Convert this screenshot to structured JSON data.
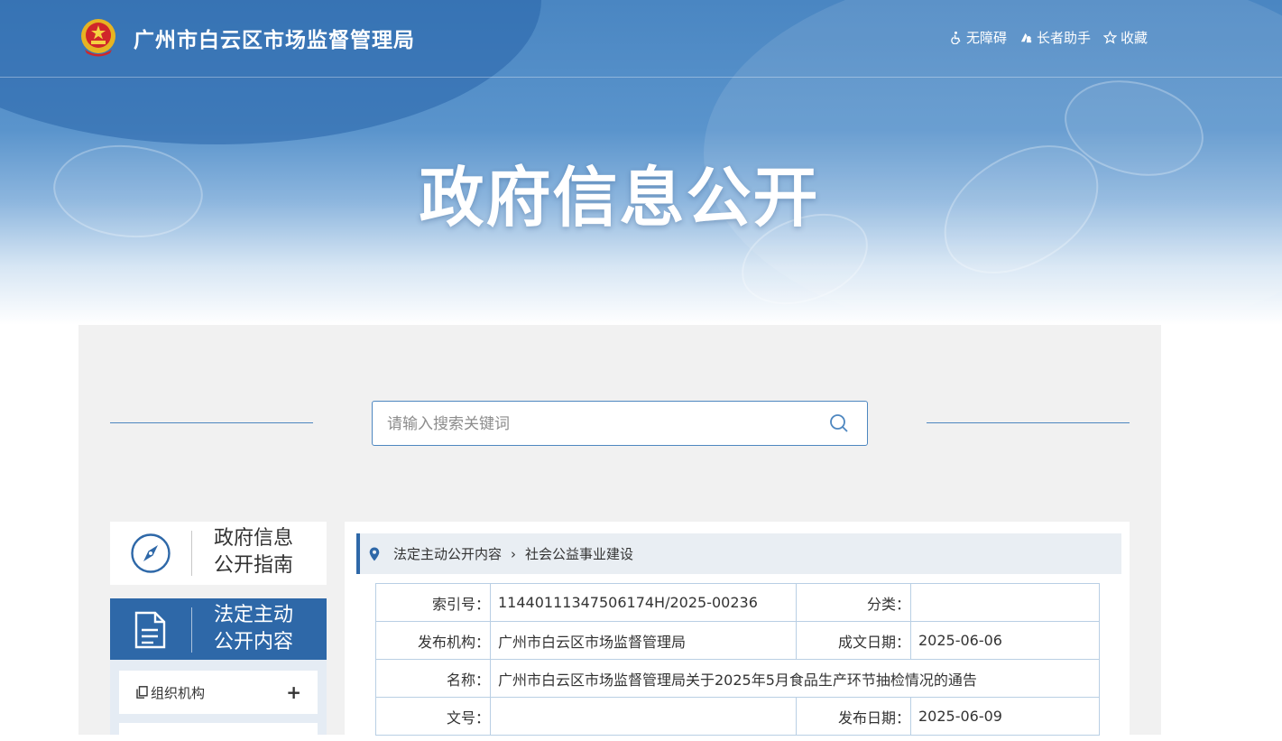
{
  "header": {
    "site_title": "广州市白云区市场监督管理局",
    "tools": [
      {
        "label": "无障碍",
        "icon": "accessibility-icon"
      },
      {
        "label": "长者助手",
        "icon": "elder-assist-icon"
      },
      {
        "label": "收藏",
        "icon": "star-icon"
      }
    ]
  },
  "banner": {
    "title": "政府信息公开"
  },
  "search": {
    "placeholder": "请输入搜索关键词"
  },
  "sidebar": {
    "guide": {
      "line1": "政府信息",
      "line2": "公开指南"
    },
    "active": {
      "line1": "法定主动",
      "line2": "公开内容"
    },
    "menu": [
      {
        "label": "组织机构",
        "toggle": "+"
      }
    ]
  },
  "breadcrumb": {
    "items": [
      "法定主动公开内容",
      "社会公益事业建设"
    ],
    "separator": "›"
  },
  "meta": {
    "index_label": "索引号：",
    "index_value": "11440111347506174H/2025-00236",
    "category_label": "分类：",
    "category_value": "",
    "publisher_label": "发布机构：",
    "publisher_value": "广州市白云区市场监督管理局",
    "written_label": "成文日期：",
    "written_value": "2025-06-06",
    "name_label": "名称：",
    "name_value": "广州市白云区市场监督管理局关于2025年5月食品生产环节抽检情况的通告",
    "docno_label": "文号：",
    "docno_value": "",
    "published_label": "发布日期：",
    "published_value": "2025-06-09"
  },
  "colors": {
    "primary": "#2e68a8",
    "banner": "#4a86c2",
    "border": "#b9cfe4",
    "background": "#f1f1f1"
  }
}
